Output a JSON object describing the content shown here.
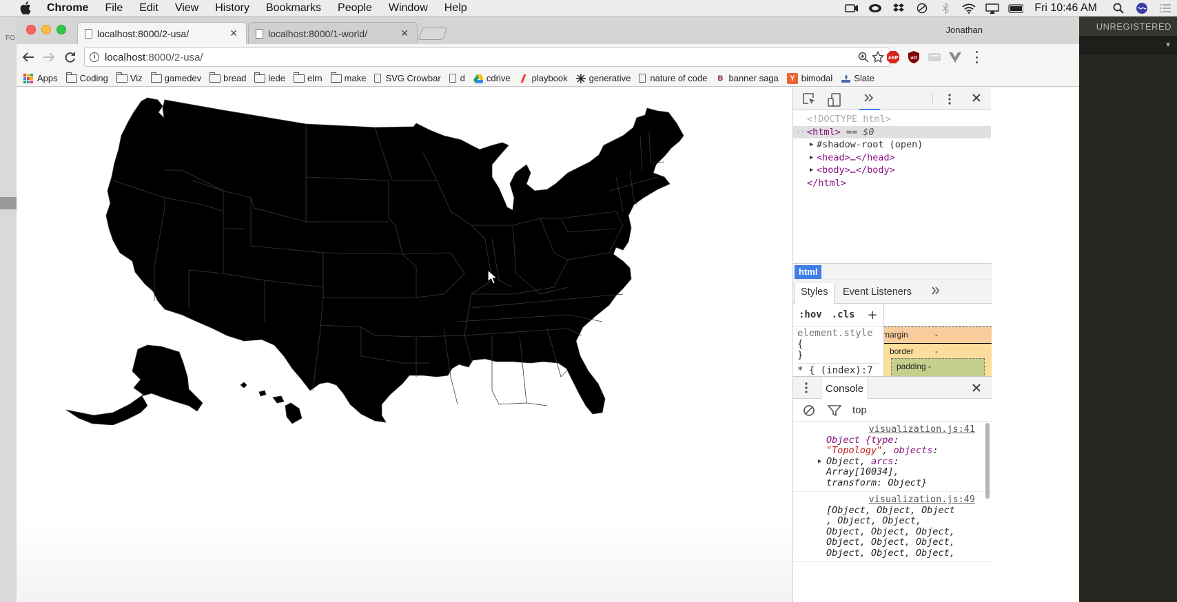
{
  "menubar": {
    "app_name": "Chrome",
    "menus": [
      "File",
      "Edit",
      "View",
      "History",
      "Bookmarks",
      "People",
      "Window",
      "Help"
    ],
    "clock": "Fri 10:46 AM"
  },
  "background_app": {
    "label": "UNREGISTERED"
  },
  "left_strip": {
    "label": "FO"
  },
  "browser": {
    "profile_name": "Jonathan",
    "tabs": [
      {
        "title": "localhost:8000/2-usa/",
        "active": true
      },
      {
        "title": "localhost:8000/1-world/",
        "active": false
      }
    ],
    "address": {
      "host": "localhost",
      "path": ":8000/2-usa/"
    },
    "extensions": [
      {
        "name": "adblock-plus-icon",
        "label": "ABP",
        "color": "#d7261e"
      },
      {
        "name": "ublock-icon",
        "label": "uO",
        "color": "#800000"
      },
      {
        "name": "extension-gray-icon",
        "label": "",
        "color": "#c9c9c9"
      },
      {
        "name": "vue-devtools-icon",
        "label": "",
        "color": "#8d8d8d"
      }
    ],
    "bookmarks": [
      {
        "type": "apps",
        "label": "Apps"
      },
      {
        "type": "folder",
        "label": "Coding"
      },
      {
        "type": "folder",
        "label": "Viz"
      },
      {
        "type": "folder",
        "label": "gamedev"
      },
      {
        "type": "folder",
        "label": "bread"
      },
      {
        "type": "folder",
        "label": "lede"
      },
      {
        "type": "folder",
        "label": "elrn"
      },
      {
        "type": "folder",
        "label": "make"
      },
      {
        "type": "page",
        "label": "SVG Crowbar"
      },
      {
        "type": "page",
        "label": "d"
      },
      {
        "type": "drive",
        "label": "cdrive"
      },
      {
        "type": "playbook",
        "label": "playbook"
      },
      {
        "type": "gen",
        "label": "generative"
      },
      {
        "type": "page",
        "label": "nature of code"
      },
      {
        "type": "b",
        "label": "banner saga"
      },
      {
        "type": "y",
        "label": "bimodal"
      },
      {
        "type": "slate",
        "label": "Slate"
      }
    ]
  },
  "devtools": {
    "dom": {
      "doctype": "<!DOCTYPE html>",
      "html_open": "<html>",
      "selected_marker": " == ",
      "selected_var": "$0",
      "shadow_root": "#shadow-root (open)",
      "head": "<head>…</head>",
      "body": "<body>…</body>",
      "html_close": "</html>"
    },
    "breadcrumb": "html",
    "styles_tabs": [
      "Styles",
      "Event Listeners"
    ],
    "styles_filter": [
      ":hov",
      ".cls",
      "+"
    ],
    "element_style": [
      "element.style",
      "{",
      "}"
    ],
    "next_rule": "* {  (index):7",
    "box_model": {
      "margin_label": "margin",
      "margin_value": "-",
      "border_label": "border",
      "border_value": "-",
      "padding_label": "padding -"
    },
    "drawer_tab": "Console",
    "console_context": "top",
    "console_messages": [
      {
        "source": "visualization.js:41",
        "lines": [
          "Object {type:",
          "\"Topology\", objects:",
          "Object, arcs:",
          "Array[10034],",
          "transform: Object}"
        ]
      },
      {
        "source": "visualization.js:49",
        "lines": [
          "[Object, Object, Object",
          ", Object, Object,",
          "Object, Object, Object,",
          "Object, Object, Object,",
          "Object, Object, Object,"
        ]
      }
    ]
  }
}
